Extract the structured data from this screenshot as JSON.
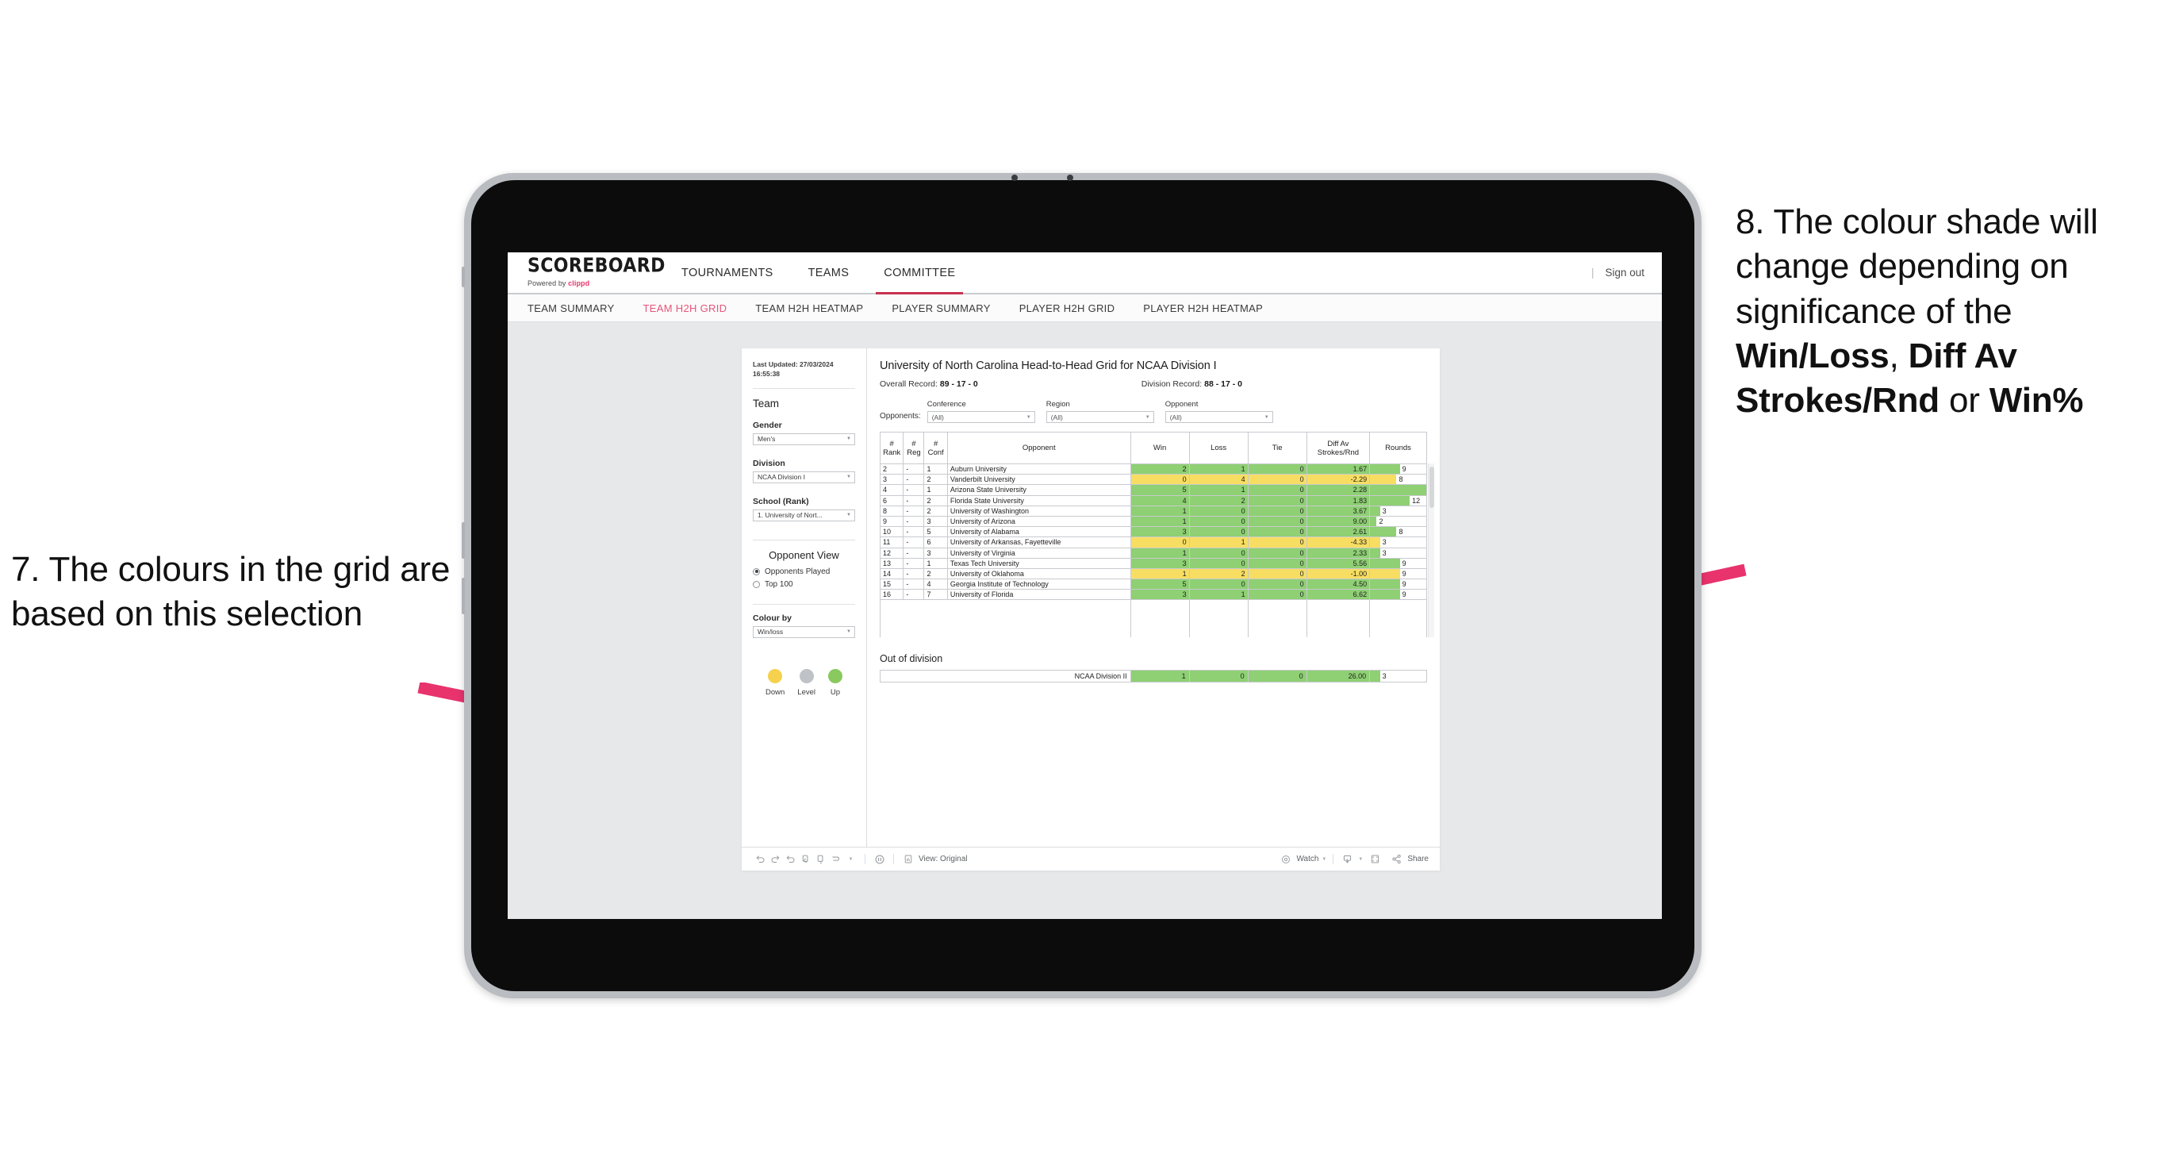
{
  "annotations": {
    "left": {
      "num": "7.",
      "text": "The colours in the grid are based on this selection"
    },
    "right_pre": "8. The colour shade will change depending on significance of the ",
    "right_b1": "Win/Loss",
    "right_mid1": ", ",
    "right_b2": "Diff Av Strokes/Rnd",
    "right_mid2": " or ",
    "right_b3": "Win%",
    "arrow_color": "#e8336d"
  },
  "app": {
    "logo": {
      "name": "SCOREBOARD",
      "powered_prefix": "Powered by ",
      "brand": "clippd"
    },
    "topnav": [
      {
        "label": "TOURNAMENTS",
        "active": false
      },
      {
        "label": "TEAMS",
        "active": false
      },
      {
        "label": "COMMITTEE",
        "active": true
      }
    ],
    "signout": "Sign out",
    "subnav": [
      {
        "label": "TEAM SUMMARY",
        "active": false
      },
      {
        "label": "TEAM H2H GRID",
        "active": true
      },
      {
        "label": "TEAM H2H HEATMAP",
        "active": false
      },
      {
        "label": "PLAYER SUMMARY",
        "active": false
      },
      {
        "label": "PLAYER H2H GRID",
        "active": false
      },
      {
        "label": "PLAYER H2H HEATMAP",
        "active": false
      }
    ]
  },
  "controls": {
    "last_updated_label": "Last Updated: 27/03/2024",
    "last_updated_time": "16:55:38",
    "team_heading": "Team",
    "gender_label": "Gender",
    "gender_value": "Men's",
    "division_label": "Division",
    "division_value": "NCAA Division I",
    "school_label": "School (Rank)",
    "school_value": "1. University of Nort...",
    "opponent_view_heading": "Opponent View",
    "opponent_view_options": [
      {
        "label": "Opponents Played",
        "selected": true
      },
      {
        "label": "Top 100",
        "selected": false
      }
    ],
    "colour_by_label": "Colour by",
    "colour_by_value": "Win/loss",
    "legend": [
      {
        "label": "Down",
        "color": "#f5d14e"
      },
      {
        "label": "Level",
        "color": "#bfc2c6"
      },
      {
        "label": "Up",
        "color": "#89c95f"
      }
    ]
  },
  "viz": {
    "title": "University of North Carolina Head-to-Head Grid for NCAA Division I",
    "overall_record_label": "Overall Record: ",
    "overall_record_value": "89 - 17 - 0",
    "division_record_label": "Division Record: ",
    "division_record_value": "88 - 17 - 0",
    "opponents_label": "Opponents:",
    "filters": [
      {
        "label": "Conference",
        "value": "(All)"
      },
      {
        "label": "Region",
        "value": "(All)"
      },
      {
        "label": "Opponent",
        "value": "(All)"
      }
    ],
    "out_of_division_heading": "Out of division"
  },
  "chart_data": {
    "type": "table",
    "title": "University of North Carolina Head-to-Head Grid for NCAA Division I",
    "columns": [
      "# Rank",
      "# Reg",
      "# Conf",
      "Opponent",
      "Win",
      "Loss",
      "Tie",
      "Diff Av Strokes/Rnd",
      "Rounds"
    ],
    "column_headers_two_line": [
      {
        "top": "#",
        "bottom": "Rank"
      },
      {
        "top": "#",
        "bottom": "Reg"
      },
      {
        "top": "#",
        "bottom": "Conf"
      },
      {
        "top": "",
        "bottom": "Opponent"
      },
      {
        "top": "",
        "bottom": "Win"
      },
      {
        "top": "",
        "bottom": "Loss"
      },
      {
        "top": "",
        "bottom": "Tie"
      },
      {
        "top": "Diff Av",
        "bottom": "Strokes/Rnd"
      },
      {
        "top": "",
        "bottom": "Rounds"
      }
    ],
    "colour_scale": {
      "up": "#8ed073",
      "down": "#f7de62",
      "level": "#bfc2c6"
    },
    "rounds_max": 17,
    "rows": [
      {
        "rank": "2",
        "reg": "-",
        "conf": "1",
        "opponent": "Auburn University",
        "win": 2,
        "loss": 1,
        "tie": 0,
        "diff": "1.67",
        "rounds": 9,
        "colour": "up"
      },
      {
        "rank": "3",
        "reg": "-",
        "conf": "2",
        "opponent": "Vanderbilt University",
        "win": 0,
        "loss": 4,
        "tie": 0,
        "diff": "-2.29",
        "rounds": 8,
        "colour": "down"
      },
      {
        "rank": "4",
        "reg": "-",
        "conf": "1",
        "opponent": "Arizona State University",
        "win": 5,
        "loss": 1,
        "tie": 0,
        "diff": "2.28",
        "rounds": 17,
        "colour": "up"
      },
      {
        "rank": "6",
        "reg": "-",
        "conf": "2",
        "opponent": "Florida State University",
        "win": 4,
        "loss": 2,
        "tie": 0,
        "diff": "1.83",
        "rounds": 12,
        "colour": "up"
      },
      {
        "rank": "8",
        "reg": "-",
        "conf": "2",
        "opponent": "University of Washington",
        "win": 1,
        "loss": 0,
        "tie": 0,
        "diff": "3.67",
        "rounds": 3,
        "colour": "up"
      },
      {
        "rank": "9",
        "reg": "-",
        "conf": "3",
        "opponent": "University of Arizona",
        "win": 1,
        "loss": 0,
        "tie": 0,
        "diff": "9.00",
        "rounds": 2,
        "colour": "up"
      },
      {
        "rank": "10",
        "reg": "-",
        "conf": "5",
        "opponent": "University of Alabama",
        "win": 3,
        "loss": 0,
        "tie": 0,
        "diff": "2.61",
        "rounds": 8,
        "colour": "up"
      },
      {
        "rank": "11",
        "reg": "-",
        "conf": "6",
        "opponent": "University of Arkansas, Fayetteville",
        "win": 0,
        "loss": 1,
        "tie": 0,
        "diff": "-4.33",
        "rounds": 3,
        "colour": "down"
      },
      {
        "rank": "12",
        "reg": "-",
        "conf": "3",
        "opponent": "University of Virginia",
        "win": 1,
        "loss": 0,
        "tie": 0,
        "diff": "2.33",
        "rounds": 3,
        "colour": "up"
      },
      {
        "rank": "13",
        "reg": "-",
        "conf": "1",
        "opponent": "Texas Tech University",
        "win": 3,
        "loss": 0,
        "tie": 0,
        "diff": "5.56",
        "rounds": 9,
        "colour": "up"
      },
      {
        "rank": "14",
        "reg": "-",
        "conf": "2",
        "opponent": "University of Oklahoma",
        "win": 1,
        "loss": 2,
        "tie": 0,
        "diff": "-1.00",
        "rounds": 9,
        "colour": "down"
      },
      {
        "rank": "15",
        "reg": "-",
        "conf": "4",
        "opponent": "Georgia Institute of Technology",
        "win": 5,
        "loss": 0,
        "tie": 0,
        "diff": "4.50",
        "rounds": 9,
        "colour": "up"
      },
      {
        "rank": "16",
        "reg": "-",
        "conf": "7",
        "opponent": "University of Florida",
        "win": 3,
        "loss": 1,
        "tie": 0,
        "diff": "6.62",
        "rounds": 9,
        "colour": "up",
        "clipped": true
      }
    ],
    "out_of_division": [
      {
        "opponent": "NCAA Division II",
        "win": 1,
        "loss": 0,
        "tie": 0,
        "diff": "26.00",
        "rounds": 3,
        "colour": "up"
      }
    ]
  },
  "toolbar": {
    "view_label": "View: Original",
    "watch_label": "Watch",
    "share_label": "Share"
  }
}
